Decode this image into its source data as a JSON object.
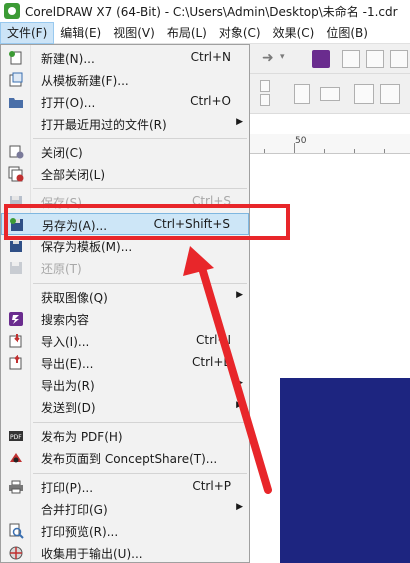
{
  "window": {
    "title": "CorelDRAW X7 (64-Bit) - C:\\Users\\Admin\\Desktop\\未命名 -1.cdr"
  },
  "menubar": [
    {
      "label": "文件(F)",
      "active": true
    },
    {
      "label": "编辑(E)"
    },
    {
      "label": "视图(V)"
    },
    {
      "label": "布局(L)"
    },
    {
      "label": "对象(C)"
    },
    {
      "label": "效果(C)"
    },
    {
      "label": "位图(B)"
    }
  ],
  "ruler": {
    "tick_label": "50"
  },
  "file_menu": [
    {
      "label": "新建(N)...",
      "shortcut": "Ctrl+N",
      "icon": "new-document-icon"
    },
    {
      "label": "从模板新建(F)...",
      "icon": "new-from-template-icon"
    },
    {
      "label": "打开(O)...",
      "shortcut": "Ctrl+O",
      "icon": "open-folder-icon"
    },
    {
      "label": "打开最近用过的文件(R)",
      "submenu": true
    },
    {
      "label": "关闭(C)",
      "icon": "close-document-icon"
    },
    {
      "label": "全部关闭(L)",
      "icon": "close-all-icon"
    },
    {
      "label": "保存(S)...",
      "shortcut": "Ctrl+S",
      "disabled": true,
      "icon": "save-icon"
    },
    {
      "label": "另存为(A)...",
      "shortcut": "Ctrl+Shift+S",
      "highlight": true,
      "icon": "save-as-icon"
    },
    {
      "label": "保存为模板(M)...",
      "icon": "save-template-icon"
    },
    {
      "label": "还原(T)",
      "disabled": true,
      "icon": "revert-icon"
    },
    {
      "label": "获取图像(Q)",
      "submenu": true
    },
    {
      "label": "搜索内容",
      "icon": "search-content-icon"
    },
    {
      "label": "导入(I)...",
      "shortcut": "Ctrl+I",
      "icon": "import-icon"
    },
    {
      "label": "导出(E)...",
      "shortcut": "Ctrl+E",
      "icon": "export-icon"
    },
    {
      "label": "导出为(R)",
      "submenu": true
    },
    {
      "label": "发送到(D)",
      "submenu": true
    },
    {
      "label": "发布为 PDF(H)",
      "icon": "pdf-icon"
    },
    {
      "label": "发布页面到 ConceptShare(T)...",
      "icon": "conceptshare-icon"
    },
    {
      "label": "打印(P)...",
      "shortcut": "Ctrl+P",
      "icon": "print-icon"
    },
    {
      "label": "合并打印(G)",
      "submenu": true
    },
    {
      "label": "打印预览(R)...",
      "icon": "print-preview-icon"
    },
    {
      "label": "收集用于输出(U)...",
      "icon": "collect-output-icon"
    }
  ],
  "colors": {
    "highlight_bg": "#cde6f7",
    "annotation_red": "#e8262a",
    "page_fill": "#1d2580"
  }
}
